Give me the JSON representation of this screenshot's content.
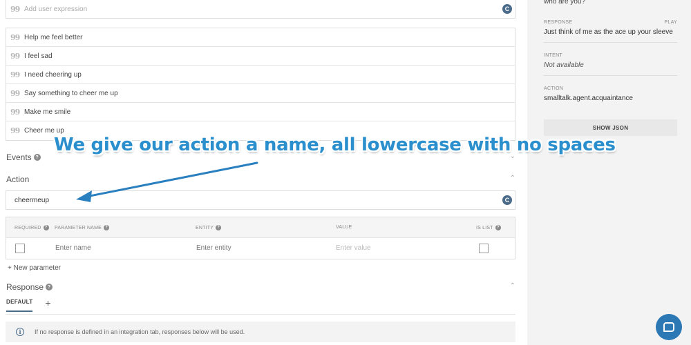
{
  "intent_editor": {
    "expression_input": {
      "placeholder": "Add user expression",
      "quote_glyph": "99",
      "icon": "c-circle-icon"
    },
    "training_phrases": [
      "Help me feel better",
      "I feel sad",
      "I need cheering up",
      "Say something to cheer me up",
      "Make me smile",
      "Cheer me up"
    ],
    "events": {
      "title": "Events",
      "help": "?",
      "collapse": "⌄"
    },
    "action": {
      "title": "Action",
      "collapse": "⌃",
      "value": "cheermeup"
    },
    "parameters": {
      "headers": [
        "REQUIRED",
        "PARAMETER NAME",
        "ENTITY",
        "VALUE",
        "IS LIST"
      ],
      "row": {
        "name_placeholder": "Enter name",
        "entity_placeholder": "Enter entity",
        "value_placeholder": "Enter value"
      },
      "new_parameter": "+ New parameter"
    },
    "response": {
      "title": "Response",
      "collapse": "⌃",
      "tabs": {
        "default": "DEFAULT",
        "add": "+"
      },
      "info": "If no response is defined in an integration tab, responses below will be used.",
      "info_icon_glyph": "i"
    }
  },
  "test_console": {
    "user_query": "who are you?",
    "response": {
      "label": "RESPONSE",
      "play": "PLAY",
      "value": "Just think of me as the ace up your sleeve"
    },
    "intent": {
      "label": "INTENT",
      "value": "Not available"
    },
    "action": {
      "label": "ACTION",
      "value": "smalltalk.agent.acquaintance"
    },
    "show_json": "SHOW JSON"
  },
  "annotation": {
    "text": "We give our action a name, all lowercase with no spaces",
    "color": "#2a8fcc"
  },
  "colors": {
    "accent": "#4a6b8a",
    "chat_bubble": "#2c78b5"
  }
}
